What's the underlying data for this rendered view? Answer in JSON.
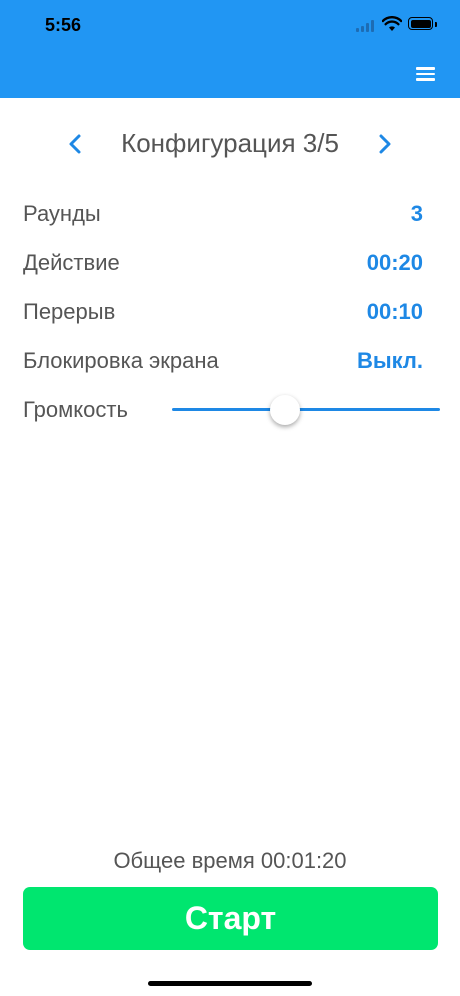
{
  "status_bar": {
    "time": "5:56"
  },
  "header": {
    "menu_icon": "hamburger-menu-icon",
    "color": "#2196f3"
  },
  "config": {
    "title": "Конфигурация 3/5",
    "prev_icon": "chevron-left-icon",
    "next_icon": "chevron-right-icon"
  },
  "settings": [
    {
      "label": "Раунды",
      "value": "3"
    },
    {
      "label": "Действие",
      "value": "00:20"
    },
    {
      "label": "Перерыв",
      "value": "00:10"
    },
    {
      "label": "Блокировка экрана",
      "value": "Выкл."
    }
  ],
  "volume": {
    "label": "Громкость",
    "level": 0.42
  },
  "footer": {
    "total_time": "Общее время 00:01:20",
    "start_label": "Старт",
    "start_color": "#00e66f"
  },
  "colors": {
    "accent": "#1e88e5",
    "text": "#555555"
  }
}
